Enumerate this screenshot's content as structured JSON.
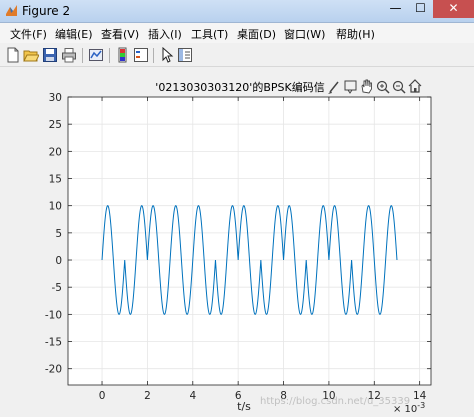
{
  "window": {
    "title": "Figure 2",
    "minimize_glyph": "—",
    "maximize_glyph": "☐",
    "close_glyph": "✕",
    "close_color": "#c75050"
  },
  "menu": [
    {
      "label": "文件(F)"
    },
    {
      "label": "编辑(E)"
    },
    {
      "label": "查看(V)"
    },
    {
      "label": "插入(I)"
    },
    {
      "label": "工具(T)"
    },
    {
      "label": "桌面(D)"
    },
    {
      "label": "窗口(W)"
    },
    {
      "label": "帮助(H)"
    }
  ],
  "toolbar_icons": [
    "new-figure-icon",
    "open-file-icon",
    "save-icon",
    "print-icon",
    "link-plot-icon",
    "insert-colorbar-icon",
    "edit-plot-arrow-icon",
    "property-inspector-icon"
  ],
  "axes_toolbar_icons": [
    "brush-icon",
    "data-tips-icon",
    "pan-hand-icon",
    "zoom-in-icon",
    "zoom-out-icon",
    "home-icon"
  ],
  "watermark": "https://blog.csdn.net/u_35339",
  "chart_data": {
    "type": "line",
    "title": "'0213030303120'的BPSK编码信",
    "xlabel": "t/s",
    "ylabel": "",
    "x_exponent_label": "× 10",
    "x_exponent": "-3",
    "xlim": [
      -1.5,
      14.5
    ],
    "ylim": [
      -23,
      30
    ],
    "xticks": [
      0,
      2,
      4,
      6,
      8,
      10,
      12,
      14
    ],
    "yticks": [
      -20,
      -15,
      -10,
      -5,
      0,
      5,
      10,
      15,
      20,
      25,
      30
    ],
    "grid": true,
    "line_color": "#0072bd",
    "series": [
      {
        "name": "",
        "t_start": 0,
        "t_end": 13,
        "amplitude": 10,
        "periods_per_unit": 1,
        "symbol_duration": 1,
        "symbol_phases_deg": [
          0,
          180,
          0,
          0,
          0,
          180,
          0,
          180,
          0,
          180,
          0,
          180,
          180
        ]
      }
    ]
  }
}
